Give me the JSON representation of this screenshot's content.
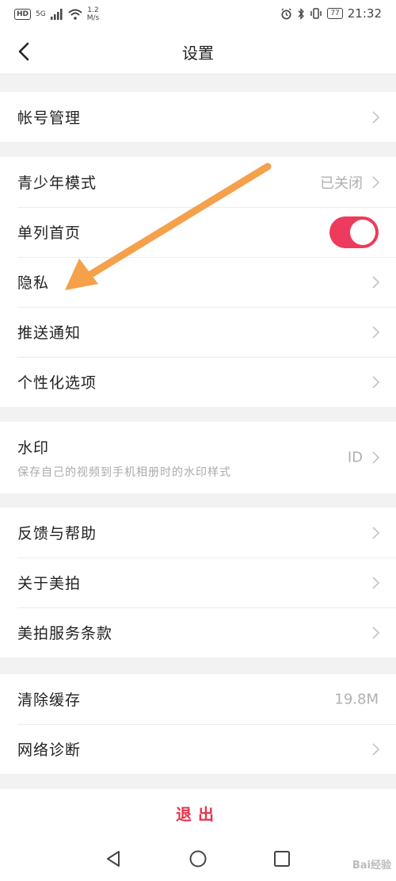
{
  "status_bar": {
    "hd_badge": "HD",
    "network": "5G",
    "speed_value": "1.2",
    "speed_unit": "M/s",
    "battery": "77",
    "time": "21:32"
  },
  "header": {
    "title": "设置"
  },
  "groups": {
    "account": {
      "label": "帐号管理"
    },
    "teen_mode": {
      "label": "青少年模式",
      "value": "已关闭"
    },
    "single_column": {
      "label": "单列首页",
      "toggle_on": true
    },
    "privacy": {
      "label": "隐私"
    },
    "push": {
      "label": "推送通知"
    },
    "personalize": {
      "label": "个性化选项"
    },
    "watermark": {
      "label": "水印",
      "subtitle": "保存自己的视频到手机相册时的水印样式",
      "value": "ID"
    },
    "feedback": {
      "label": "反馈与帮助"
    },
    "about": {
      "label": "关于美拍"
    },
    "terms": {
      "label": "美拍服务条款"
    },
    "cache": {
      "label": "清除缓存",
      "value": "19.8M"
    },
    "network_diag": {
      "label": "网络诊断"
    }
  },
  "logout_label": "退出",
  "colors": {
    "toggle_on": "#ee3a5c",
    "logout": "#e8334a",
    "annotation_arrow": "#f5a04a"
  },
  "watermark_text": "Bai经验"
}
